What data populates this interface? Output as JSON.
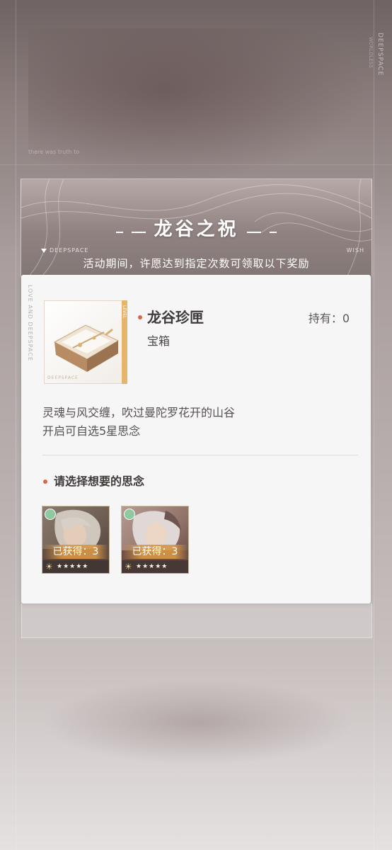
{
  "background": {
    "brand_vertical": "DEEPSPACE",
    "brand_vertical_sub": "WORLDLESS",
    "faint_text": "there was truth to"
  },
  "header": {
    "title": "龙谷之祝",
    "deep_label": "DEEPSPACE",
    "wish_label": "WISH",
    "subtitle": "活动期间，许愿达到指定次数可领取以下奖励"
  },
  "reward": {
    "side_text": "LOVE AND DEEPSPACE",
    "frame_tag": "DEEPSPACE",
    "gold_text": "LEVEL",
    "name": "龙谷珍匣",
    "type": "宝箱",
    "owned": "持有：0",
    "description_line1": "灵魂与风交缠，吹过曼陀罗花开的山谷",
    "description_line2": "开启可自选5星思念"
  },
  "choose": {
    "title": "请选择想要的思念",
    "memories": [
      {
        "obtained": "已获得：3",
        "sun": "☀",
        "stars": "★★★★★"
      },
      {
        "obtained": "已获得：3",
        "sun": "☀",
        "stars": "★★★★★"
      }
    ]
  },
  "colors": {
    "accent_dot": "#d9664a",
    "obtained_band": "#d6964a",
    "card_bg": "#f7f6f6"
  }
}
